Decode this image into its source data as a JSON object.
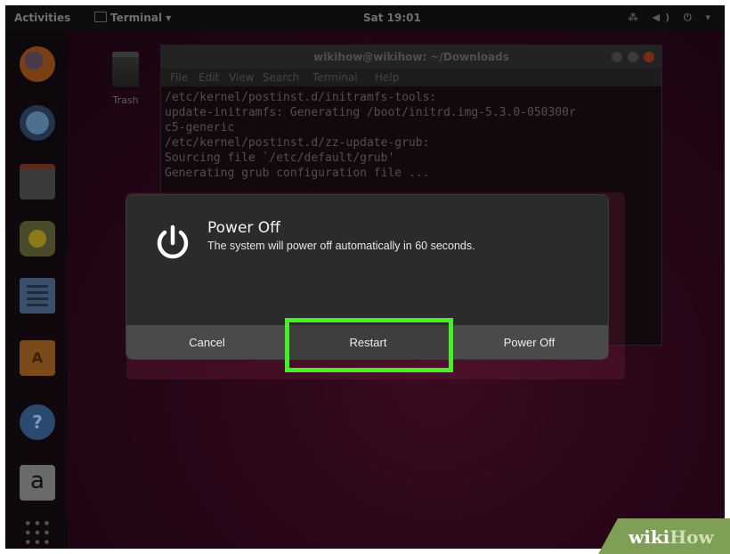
{
  "topbar": {
    "activities": "Activities",
    "app_name": "Terminal ▾",
    "clock": "Sat 19:01",
    "tray": "⁂ ◀) ⏻ ▾"
  },
  "dock": {
    "items": [
      "firefox-icon",
      "thunderbird-icon",
      "files-icon",
      "rhythmbox-icon",
      "writer-icon",
      "software-icon",
      "help-icon",
      "amazon-icon",
      "apps-grid-icon"
    ],
    "software_glyph": "A",
    "help_glyph": "?",
    "amazon_glyph": "a"
  },
  "desktop": {
    "trash_label": "Trash"
  },
  "terminal": {
    "title": "wikihow@wikihow: ~/Downloads",
    "menu": [
      "File",
      "Edit",
      "View",
      "Search",
      "Terminal",
      "Help"
    ],
    "lines": [
      "/etc/kernel/postinst.d/initramfs-tools:",
      "update-initramfs: Generating /boot/initrd.img-5.3.0-050300r",
      "c5-generic",
      "/etc/kernel/postinst.d/zz-update-grub:",
      "Sourcing file `/etc/default/grub'",
      "Generating grub configuration file ..."
    ]
  },
  "dialog": {
    "title": "Power Off",
    "message": "The system will power off automatically in 60 seconds.",
    "buttons": {
      "cancel": "Cancel",
      "restart": "Restart",
      "power_off": "Power Off"
    }
  },
  "colors": {
    "highlight": "#43f224",
    "dialog_bg": "#2b2b2b",
    "button_bar": "#4a4a4a",
    "watermark_green": "#7f9f57"
  },
  "watermark": {
    "wiki": "wiki",
    "how": "How"
  }
}
